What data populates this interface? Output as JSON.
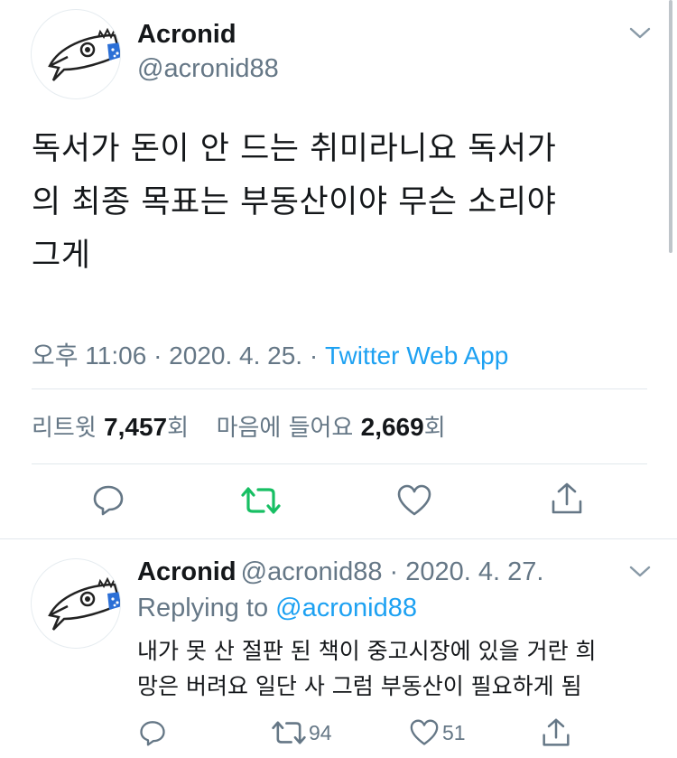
{
  "main_tweet": {
    "display_name": "Acronid",
    "handle": "@acronid88",
    "text_lines": [
      "독서가 돈이 안 드는 취미라니요 독서가",
      "의 최종 목표는 부동산이야 무슨 소리야",
      "그게"
    ],
    "time": "오후 11:06 · 2020. 4. 25. · ",
    "source": "Twitter Web App",
    "retweets_label": "리트윗 ",
    "retweets_count": "7,457",
    "retweets_suffix": "회",
    "likes_label": "마음에 들어요 ",
    "likes_count": "2,669",
    "likes_suffix": "회"
  },
  "reply_tweet": {
    "display_name": "Acronid",
    "handle_date": "@acronid88 · 2020. 4. 27.",
    "replying_prefix": "Replying to ",
    "replying_handle": "@acronid88",
    "text_lines": [
      "내가 못 산 절판 된 책이 중고시장에 있을 거란 희",
      "망은 버려요 일단 사 그럼 부동산이 필요하게 됨"
    ],
    "retweet_count": "94",
    "like_count": "51"
  },
  "colors": {
    "accent": "#1da1f2",
    "retweet_green": "#17bf63",
    "secondary_text": "#657786",
    "icon_gray": "#657786"
  },
  "icons": [
    "chevron-down-icon",
    "reply-icon",
    "retweet-icon",
    "like-icon",
    "share-icon"
  ]
}
